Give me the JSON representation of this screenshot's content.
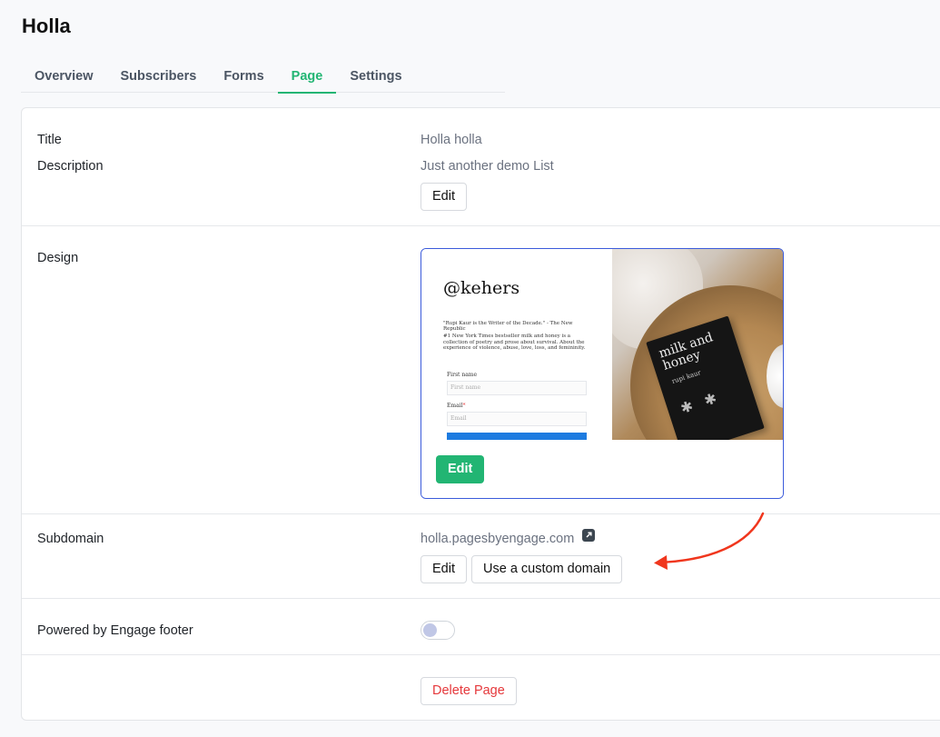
{
  "page": {
    "title": "Holla"
  },
  "tabs": [
    {
      "label": "Overview"
    },
    {
      "label": "Subscribers"
    },
    {
      "label": "Forms"
    },
    {
      "label": "Page",
      "active": true
    },
    {
      "label": "Settings"
    }
  ],
  "details": {
    "title_label": "Title",
    "title_value": "Holla holla",
    "description_label": "Description",
    "description_value": "Just another demo List",
    "edit_label": "Edit"
  },
  "design": {
    "label": "Design",
    "edit_label": "Edit",
    "preview": {
      "handle": "@kehers",
      "quote": "\"Rupi Kaur is the Writer of the Decade.\" - The New Republic",
      "description": "#1 New York Times bestseller milk and honey is a collection of poetry and prose about survival. About the experience of violence, abuse, love, loss, and femininity.",
      "first_name_label": "First name",
      "first_name_placeholder": "First name",
      "email_label": "Email",
      "email_required": "*",
      "email_placeholder": "Email",
      "book_title": "milk and honey",
      "book_author": "rupi kaur"
    }
  },
  "subdomain": {
    "label": "Subdomain",
    "value": "holla.pagesbyengage.com",
    "edit_label": "Edit",
    "custom_domain_label": "Use a custom domain"
  },
  "footer_toggle": {
    "label": "Powered by Engage footer",
    "enabled": false
  },
  "danger": {
    "delete_label": "Delete Page"
  },
  "colors": {
    "accent": "#22b573",
    "danger": "#e5383b",
    "annotation_arrow": "#f0361d",
    "preview_border": "#3b5bdb"
  }
}
